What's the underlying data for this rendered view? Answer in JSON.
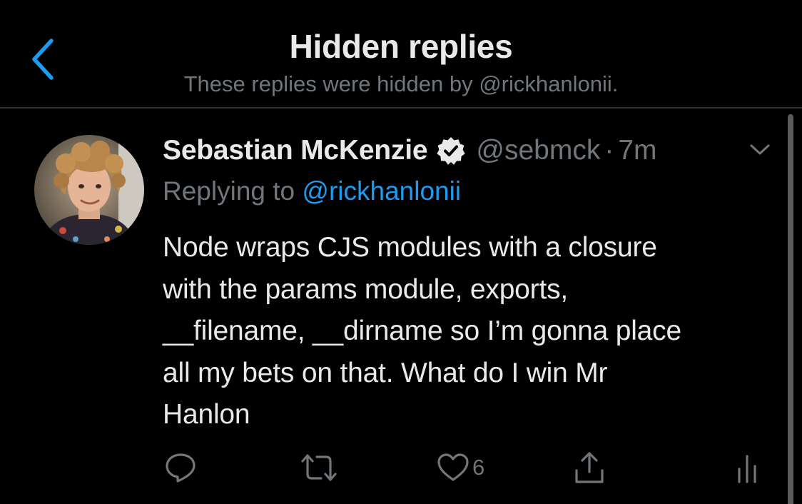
{
  "header": {
    "title": "Hidden replies",
    "subtitle": "These replies were hidden by @rickhanlonii."
  },
  "tweet": {
    "author_name": "Sebastian McKenzie",
    "handle": "@sebmck",
    "separator": "·",
    "time": "7m",
    "replying_prefix": "Replying to ",
    "replying_to": "@rickhanlonii",
    "body_lines": [
      "Node wraps CJS modules with a closure",
      "with the params module, exports,",
      "__filename, __dirname so I’m gonna place",
      "all my bets on that. What do I win Mr",
      "Hanlon"
    ],
    "like_count": "6"
  },
  "icons": {
    "back": "chevron-left-icon",
    "verified": "verified-badge-icon",
    "caret": "chevron-down-icon",
    "reply": "reply-bubble-icon",
    "retweet": "retweet-icon",
    "like": "heart-icon",
    "share": "share-icon",
    "analytics": "analytics-icon"
  },
  "colors": {
    "background": "#000000",
    "text": "#e7e9ea",
    "muted": "#71767b",
    "accent": "#1d9bf0",
    "divider": "#2f3336"
  }
}
